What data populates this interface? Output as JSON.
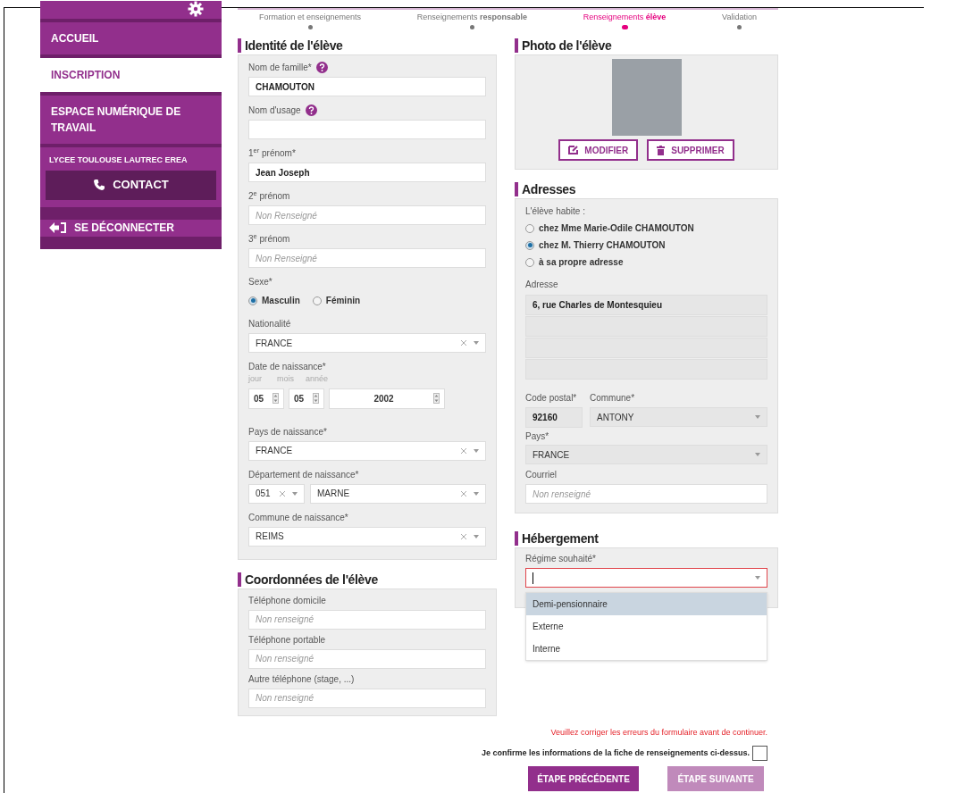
{
  "sidebar": {
    "items": [
      {
        "label": "ACCUEIL",
        "selected": false
      },
      {
        "label": "INSCRIPTION",
        "selected": true
      },
      {
        "label": "ESPACE NUMÉRIQUE DE TRAVAIL",
        "selected": false
      }
    ],
    "school": "LYCEE TOULOUSE LAUTREC EREA",
    "contact": "CONTACT",
    "logout": "SE DÉCONNECTER"
  },
  "stepper": {
    "steps": [
      {
        "label": "Formation et enseignements",
        "selected": false
      },
      {
        "label": "Renseignements **responsable**",
        "selected": false
      },
      {
        "label": "Renseignements **élève**",
        "selected": true
      },
      {
        "label": "Validation",
        "selected": false
      }
    ]
  },
  "identity": {
    "title": "Identité de l'élève",
    "fields": [
      {
        "kind": "text",
        "label": "Nom de famille*",
        "help": true,
        "value": "CHAMOUTON"
      },
      {
        "kind": "text",
        "label": "Nom d'usage",
        "help": true
      },
      {
        "kind": "text",
        "label": "1$^{er}$ prénom*",
        "help": false,
        "value": "Jean Joseph"
      },
      {
        "kind": "text",
        "label": "2$^{e}$ prénom",
        "help": false,
        "placeholder": "Non Renseigné"
      },
      {
        "kind": "text",
        "label": "3$^{e}$ prénom",
        "help": false,
        "placeholder": "Non Renseigné"
      },
      {
        "kind": "radio",
        "label": "Sexe*",
        "options": [
          {
            "label": "Masculin",
            "selected": true
          },
          {
            "label": "Féminin",
            "selected": false
          }
        ]
      },
      {
        "kind": "select",
        "label": "Nationalité",
        "value": "FRANCE"
      },
      {
        "kind": "date",
        "label": "Date de naissance*",
        "parts": [
          {
            "sublabel": "jour",
            "value": "05"
          },
          {
            "sublabel": "mois",
            "value": "05"
          },
          {
            "sublabel": "année",
            "value": "2002"
          }
        ]
      },
      {
        "kind": "select",
        "label": "Pays de naissance*",
        "value": "FRANCE"
      },
      {
        "kind": "dept",
        "label": "Département de naissance*",
        "code": "051",
        "value": "MARNE"
      },
      {
        "kind": "select",
        "label": "Commune de naissance*",
        "value": "REIMS"
      }
    ]
  },
  "contact_info": {
    "title": "Coordonnées de l'élève",
    "fields": [
      {
        "label": "Téléphone domicile",
        "placeholder": "Non renseigné"
      },
      {
        "label": "Téléphone portable",
        "placeholder": "Non renseigné"
      },
      {
        "label": "Autre téléphone (stage, ...)",
        "placeholder": "Non renseigné"
      }
    ]
  },
  "photo": {
    "title": "Photo de l'élève",
    "buttons": [
      {
        "kind": "edit",
        "label": "MODIFIER"
      },
      {
        "kind": "delete",
        "label": "SUPPRIMER"
      }
    ]
  },
  "addresses": {
    "title": "Adresses",
    "lives_label": "L'élève habite :",
    "options": [
      {
        "label": "chez Mme Marie-Odile CHAMOUTON",
        "selected": false
      },
      {
        "label": "chez M. Thierry CHAMOUTON",
        "selected": true
      },
      {
        "label": "à sa propre adresse",
        "selected": false
      }
    ],
    "address_label": "Adresse",
    "address_lines": [
      {
        "value": "6, rue Charles de Montesquieu",
        "disabled": true
      },
      {
        "disabled": true
      },
      {
        "disabled": true
      },
      {
        "disabled": true
      }
    ],
    "postal_label": "Code postal*",
    "postal": {
      "value": "92160",
      "disabled": true
    },
    "city_label": "Commune*",
    "city": {
      "value": "ANTONY",
      "disabled": true
    },
    "country_label": "Pays*",
    "country": {
      "value": "FRANCE",
      "disabled": true
    },
    "email_label": "Courriel",
    "email": {
      "placeholder": "Non renseigné",
      "disabled": false
    }
  },
  "lodging": {
    "title": "Hébergement",
    "label": "Régime souhaité*",
    "error": true,
    "options": [
      {
        "label": "Demi-pensionnaire",
        "selected": true
      },
      {
        "label": "Externe",
        "selected": false
      },
      {
        "label": "Interne",
        "selected": false
      }
    ]
  },
  "error_message": "Veuillez corriger les erreurs du formulaire avant de continuer.",
  "confirm": {
    "label": "Je confirme les informations de la fiche de renseignements ci-dessus.",
    "checked": false
  },
  "buttons": [
    {
      "label": "ÉTAPE PRÉCÉDENTE",
      "disabled": false
    },
    {
      "label": "ÉTAPE SUIVANTE",
      "disabled": true
    }
  ]
}
